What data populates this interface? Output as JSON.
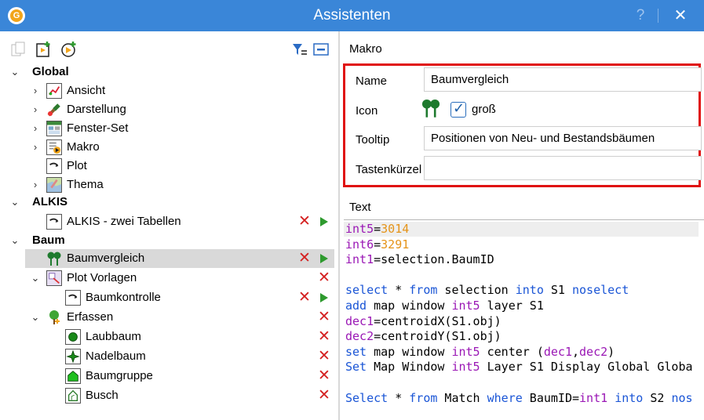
{
  "window": {
    "title": "Assistenten",
    "help_label": "?",
    "close_label": "✕",
    "app_icon_letter": "G"
  },
  "toolbar": {
    "icons": [
      "copy-icon",
      "add-macro-icon",
      "add-play-icon",
      "filter-icon",
      "collapse-all-icon"
    ]
  },
  "tree": {
    "global": {
      "label": "Global",
      "children": [
        "Ansicht",
        "Darstellung",
        "Fenster-Set",
        "Makro",
        "Plot",
        "Thema"
      ]
    },
    "alkis": {
      "label": "ALKIS",
      "children": [
        "ALKIS - zwei Tabellen"
      ]
    },
    "baum": {
      "label": "Baum",
      "items": {
        "baumvergleich": "Baumvergleich",
        "plot_vorlagen": "Plot Vorlagen",
        "baumkontrolle": "Baumkontrolle",
        "erfassen": "Erfassen",
        "laubbaum": "Laubbaum",
        "nadelbaum": "Nadelbaum",
        "baumgruppe": "Baumgruppe",
        "busch": "Busch"
      }
    }
  },
  "macro": {
    "group_title": "Makro",
    "name_label": "Name",
    "name_value": "Baumvergleich",
    "icon_label": "Icon",
    "gross_label": "groß",
    "gross_checked": true,
    "tooltip_label": "Tooltip",
    "tooltip_value": "Positionen von Neu- und Bestandsbäumen",
    "shortcut_label": "Tastenkürzel",
    "shortcut_value": ""
  },
  "text": {
    "title": "Text",
    "lines": [
      [
        [
          "var",
          "int5"
        ],
        [
          "tx",
          "="
        ],
        [
          "num",
          "3014"
        ]
      ],
      [
        [
          "var",
          "int6"
        ],
        [
          "tx",
          "="
        ],
        [
          "num",
          "3291"
        ]
      ],
      [
        [
          "var",
          "int1"
        ],
        [
          "tx",
          "=selection.BaumID"
        ]
      ],
      [],
      [
        [
          "kw",
          "select"
        ],
        [
          "tx",
          " * "
        ],
        [
          "kw",
          "from"
        ],
        [
          "tx",
          " selection "
        ],
        [
          "kw",
          "into"
        ],
        [
          "tx",
          " S1 "
        ],
        [
          "kw",
          "noselect"
        ]
      ],
      [
        [
          "kw",
          "add"
        ],
        [
          "tx",
          " map window "
        ],
        [
          "var",
          "int5"
        ],
        [
          "tx",
          " layer S1"
        ]
      ],
      [
        [
          "var",
          "dec1"
        ],
        [
          "tx",
          "=centroidX(S1.obj)"
        ]
      ],
      [
        [
          "var",
          "dec2"
        ],
        [
          "tx",
          "=centroidY(S1.obj)"
        ]
      ],
      [
        [
          "kw",
          "set"
        ],
        [
          "tx",
          " map window "
        ],
        [
          "var",
          "int5"
        ],
        [
          "tx",
          " center ("
        ],
        [
          "var",
          "dec1"
        ],
        [
          "tx",
          ","
        ],
        [
          "var",
          "dec2"
        ],
        [
          "tx",
          ")"
        ]
      ],
      [
        [
          "kw",
          "Set"
        ],
        [
          "tx",
          " Map Window "
        ],
        [
          "var",
          "int5"
        ],
        [
          "tx",
          " Layer S1 Display Global Globa"
        ]
      ],
      [],
      [
        [
          "kw",
          "Select"
        ],
        [
          "tx",
          " * "
        ],
        [
          "kw",
          "from"
        ],
        [
          "tx",
          " Match "
        ],
        [
          "kw",
          "where"
        ],
        [
          "tx",
          " BaumID="
        ],
        [
          "var",
          "int1"
        ],
        [
          "tx",
          " "
        ],
        [
          "kw",
          "into"
        ],
        [
          "tx",
          " S2 "
        ],
        [
          "kw",
          "nos"
        ]
      ]
    ]
  },
  "colors": {
    "titlebar": "#3a86d8",
    "highlight_box": "#e01010",
    "keyword": "#1a55d6",
    "variable": "#9a17b5",
    "number": "#e5941a",
    "delete": "#d42020",
    "run": "#2e9a2e"
  }
}
